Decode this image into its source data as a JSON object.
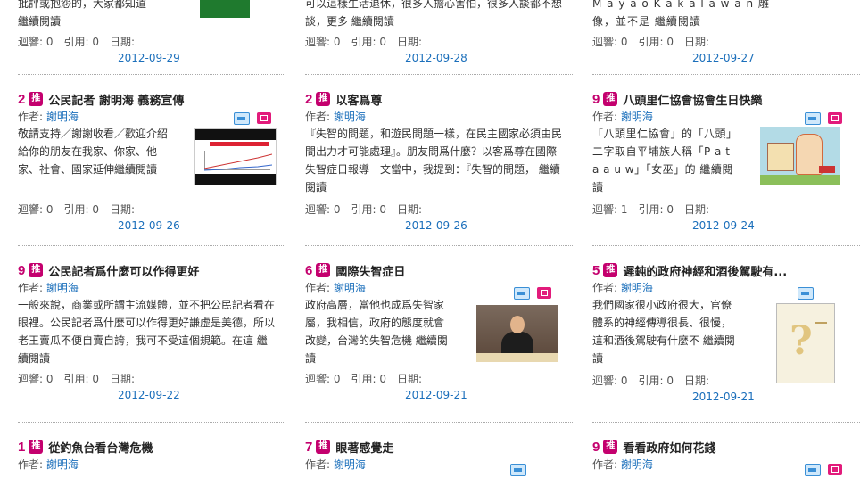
{
  "columns": [
    [
      {
        "desc": "批評或抱怨的，大家都知道",
        "desc2": "繼續閱讀",
        "stats": "迴響: 0　引用: 0　日期:",
        "date": "2012-09-29"
      },
      {
        "num": "2",
        "title": "公民記者 謝明海 義務宣傳",
        "author_label": "作者:",
        "author": "謝明海",
        "desc": "敬請支持／謝謝收看／歡迎介紹給你的朋友在我家、你家、他家、社會、國家延伸繼續閱讀",
        "stats": "迴響: 0　引用: 0　日期:",
        "date": "2012-09-26"
      },
      {
        "num": "9",
        "title": "公民記者爲什麼可以作得更好",
        "author_label": "作者:",
        "author": "謝明海",
        "desc": "一般來說，商業或所謂主流媒體，並不把公民記者看在眼裡。公民記者爲什麼可以作得更好謙虛是美德，所以老王賣瓜不便自賣自誇，我可不受這個規範。在這 繼續閱讀",
        "stats": "迴響: 0　引用: 0　日期:",
        "date": "2012-09-22"
      },
      {
        "num": "1",
        "title": "從釣魚台看台灣危機",
        "author_label": "作者:",
        "author": "謝明海"
      }
    ],
    [
      {
        "desc": "可以這樣生活退休，很多人擔心害怕，很多人談都不想談，更多 繼續閱讀",
        "stats": "迴響: 0　引用: 0　日期:",
        "date": "2012-09-28"
      },
      {
        "num": "2",
        "title": "以客爲尊",
        "author_label": "作者:",
        "author": "謝明海",
        "desc": "『失智的問題，和遊民問題一樣，在民主國家必須由民間出力才可能處理』。朋友問爲什麼？以客爲尊在國際失智症日報導一文當中，我提到：『失智的問題， 繼續閱讀",
        "stats": "迴響: 0　引用: 0　日期:",
        "date": "2012-09-26"
      },
      {
        "num": "6",
        "title": "國際失智症日",
        "author_label": "作者:",
        "author": "謝明海",
        "desc": "政府高層，當他也成爲失智家屬，我相信，政府的態度就會改變，台灣的失智危機 繼續閱讀",
        "stats": "迴響: 0　引用: 0　日期:",
        "date": "2012-09-21"
      },
      {
        "num": "7",
        "title": "眼著感覺走",
        "author_label": "作者:",
        "author": "謝明海"
      }
    ],
    [
      {
        "desc": "M a y a o K a k a l a w a n 雕像，並不是 繼續閱讀",
        "stats": "迴響: 0　引用: 0　日期:",
        "date": "2012-09-27"
      },
      {
        "num": "9",
        "title": "八頭里仁協會協會生日快樂",
        "author_label": "作者:",
        "author": "謝明海",
        "desc": "「八頭里仁協會」的「八頭」二字取自平埔族人稱「P a t a a u w」「女巫」的 繼續閱讀",
        "stats": "迴響: 1　引用: 0　日期:",
        "date": "2012-09-24"
      },
      {
        "num": "5",
        "title": "遲鈍的政府神經和酒後駕駛有...",
        "author_label": "作者:",
        "author": "謝明海",
        "desc": "我們國家很小政府很大，官僚體系的神經傳導很長、很慢，這和酒後駕駛有什麼不 繼續閱讀",
        "stats": "迴響: 0　引用: 0　日期:",
        "date": "2012-09-21"
      },
      {
        "num": "9",
        "title": "看看政府如何花錢",
        "author_label": "作者:",
        "author": "謝明海"
      }
    ]
  ],
  "badge_label": "推",
  "icons": {
    "image": "image-icon",
    "video": "video-icon",
    "recommend": "recommend-badge"
  },
  "colors": {
    "accent": "#c4006e",
    "link": "#1b6fbb"
  }
}
